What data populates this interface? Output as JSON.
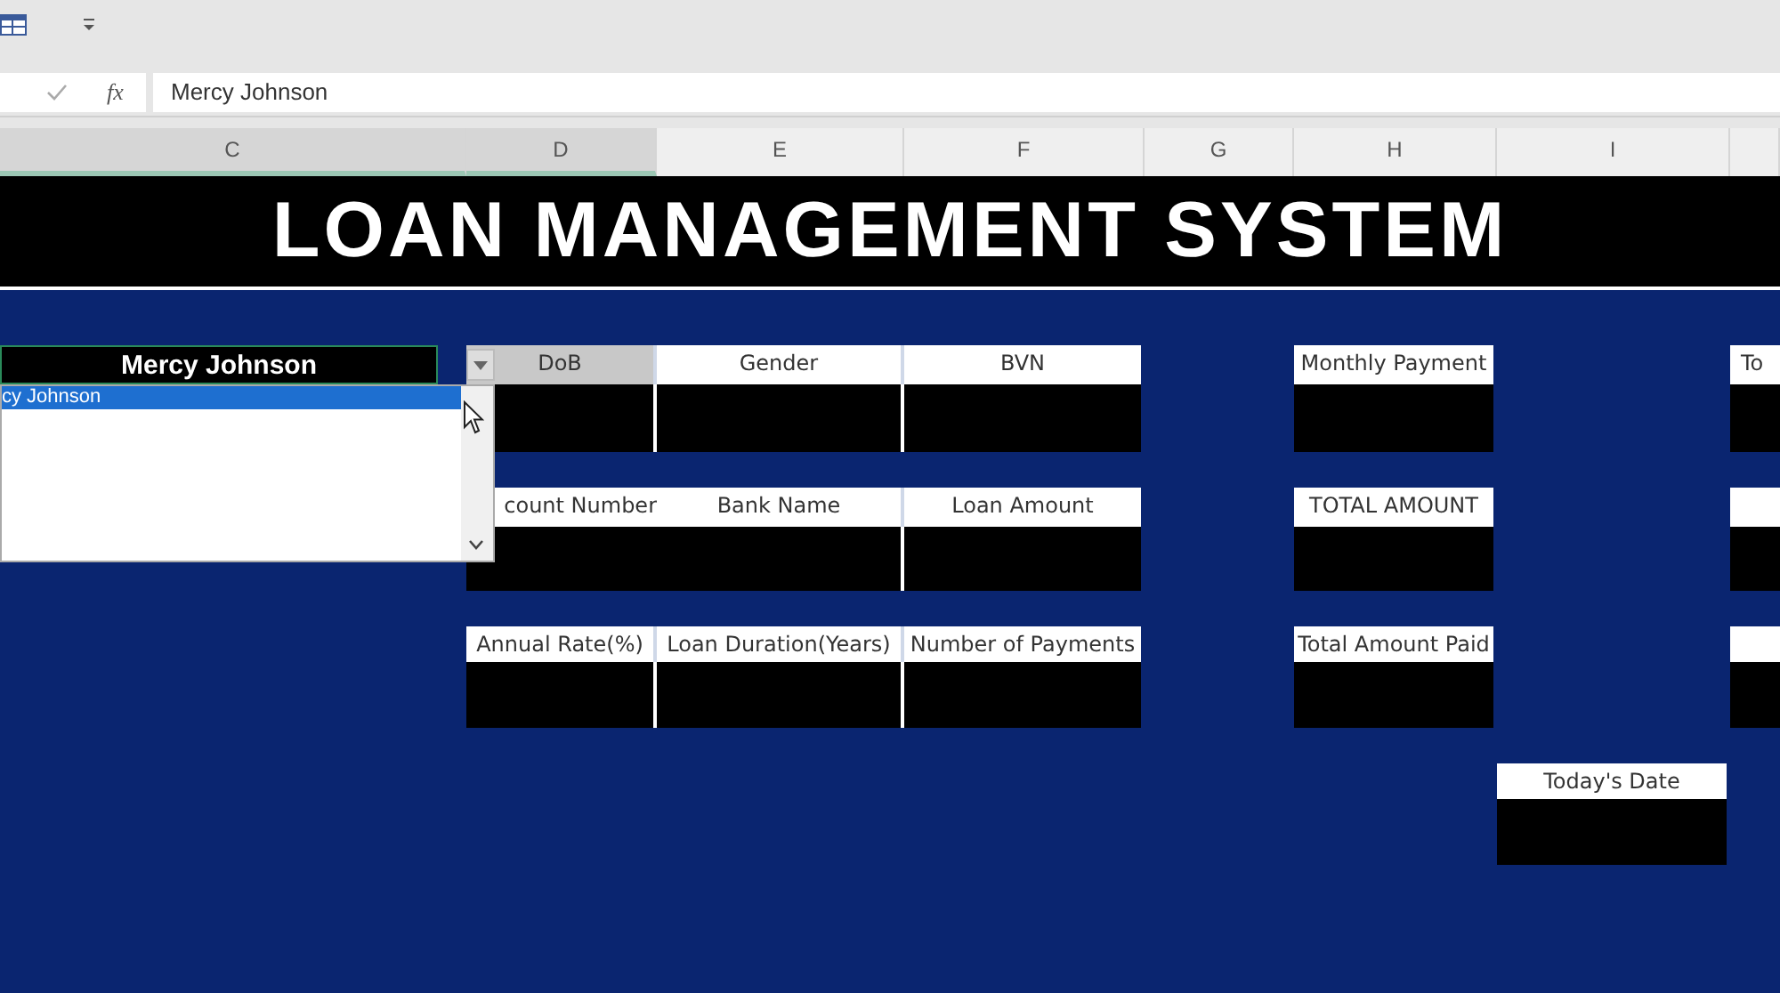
{
  "formula_bar": {
    "value": "Mercy Johnson",
    "fx": "fx"
  },
  "columns": [
    {
      "label": "C",
      "selected": true
    },
    {
      "label": "D",
      "selected": true
    },
    {
      "label": "E",
      "selected": false
    },
    {
      "label": "F",
      "selected": false
    },
    {
      "label": "G",
      "selected": false
    },
    {
      "label": "H",
      "selected": false
    },
    {
      "label": "I",
      "selected": false
    }
  ],
  "title": "LOAN MANAGEMENT SYSTEM",
  "name_field": {
    "value": "Mercy Johnson",
    "list_items": [
      {
        "label": "cy Johnson",
        "selected": true
      }
    ]
  },
  "fields": [
    {
      "label": "DoB",
      "highlighted": true
    },
    {
      "label": "Gender",
      "highlighted": false
    },
    {
      "label": "BVN",
      "highlighted": false
    },
    {
      "label": "Monthly Payment",
      "highlighted": false
    },
    {
      "label": "To",
      "highlighted": false
    },
    {
      "label": "count Number",
      "highlighted": false
    },
    {
      "label": "Bank Name",
      "highlighted": false
    },
    {
      "label": "Loan Amount",
      "highlighted": false
    },
    {
      "label": "TOTAL AMOUNT",
      "highlighted": false
    },
    {
      "highlighted": false
    },
    {
      "label": "Annual Rate(%)",
      "highlighted": false
    },
    {
      "label": "Loan Duration(Years)",
      "highlighted": false
    },
    {
      "label": "Number of Payments",
      "highlighted": false
    },
    {
      "label": "Total Amount Paid",
      "highlighted": false
    },
    {
      "highlighted": false
    },
    {
      "label": "Today's Date",
      "highlighted": false
    }
  ]
}
